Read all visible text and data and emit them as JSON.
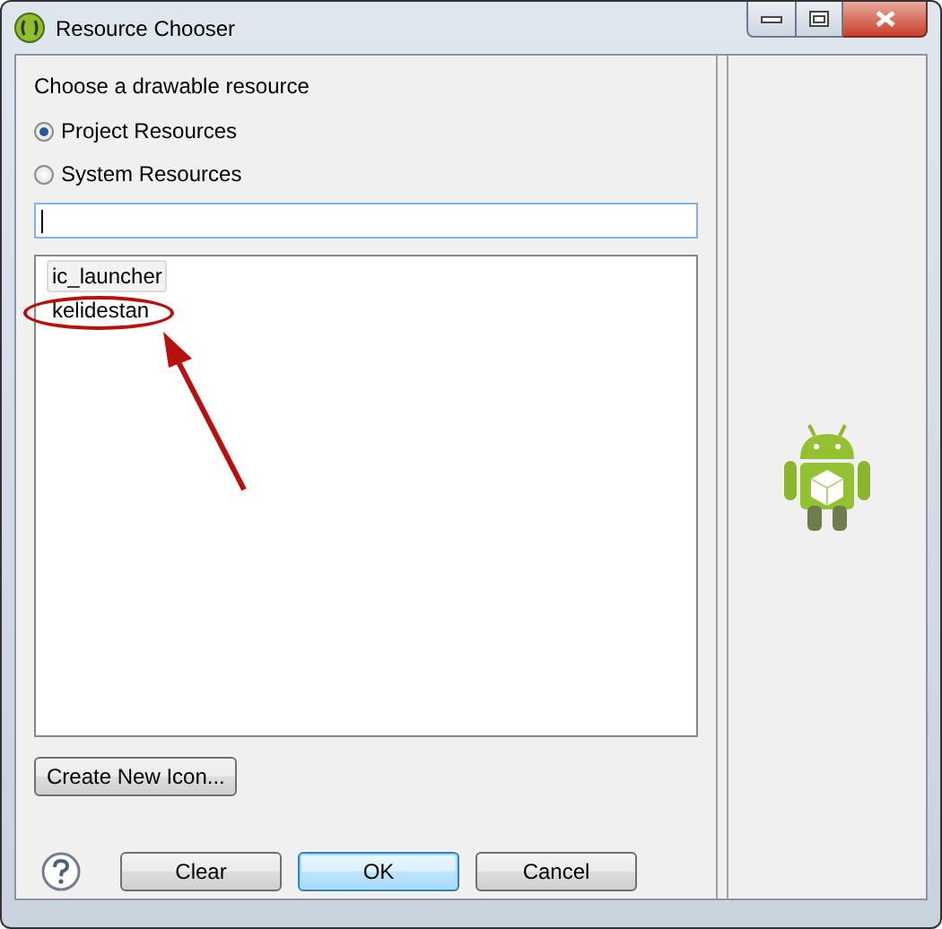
{
  "window": {
    "title": "Resource Chooser"
  },
  "prompt": "Choose a drawable resource",
  "radios": [
    {
      "label": "Project Resources",
      "selected": true
    },
    {
      "label": "System Resources",
      "selected": false
    }
  ],
  "resources": [
    {
      "label": "ic_launcher",
      "selected": true
    },
    {
      "label": "kelidestan",
      "selected": false
    }
  ],
  "create_button": "Create New Icon...",
  "buttons": [
    {
      "label": "Clear",
      "default": false
    },
    {
      "label": "OK",
      "default": true
    },
    {
      "label": "Cancel",
      "default": false
    }
  ]
}
